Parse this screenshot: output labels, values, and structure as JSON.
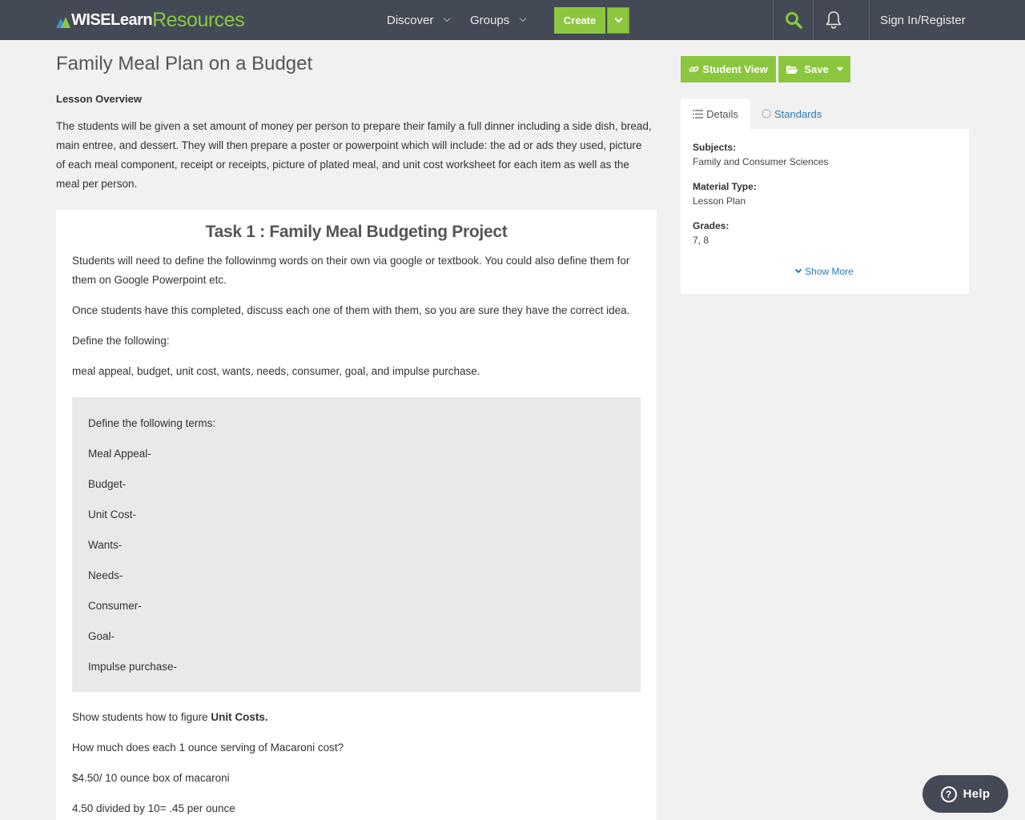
{
  "brand": {
    "part1": "WISELearn",
    "part2": "Resources"
  },
  "nav": {
    "discover": "Discover",
    "groups": "Groups",
    "create": "Create",
    "signin": "Sign In/Register"
  },
  "page": {
    "title": "Family Meal Plan on a Budget",
    "overview_label": "Lesson Overview",
    "overview_text": "The students will be given a set amount of money per person to prepare their family a full dinner including a side dish, bread, main entree, and dessert.  They will then prepare a poster or powerpoint which will include: the ad or ads they used, picture of each meal component, receipt or receipts, picture of plated meal, and unit cost worksheet for each item as well as the meal per person."
  },
  "task": {
    "title": "Task 1 : Family Meal Budgeting Project",
    "p1": "Students will need to define the followinmg words on their own via google or textbook.  You could also define them for them on Google Powerpoint etc.",
    "p2": "Once students have this completed, discuss each one of them with them, so you are sure they have the correct idea.",
    "p3": "Define the following:",
    "p4": "meal appeal, budget, unit cost, wants, needs, consumer, goal, and impulse purchase.",
    "terms_heading": "Define the following terms:",
    "terms": [
      "Meal Appeal-",
      "Budget-",
      "Unit Cost-",
      "Wants-",
      "Needs-",
      "Consumer-",
      "Goal-",
      "Impulse purchase-"
    ],
    "unit_cost_prefix": "Show students how to figure ",
    "unit_cost_bold": "Unit Costs.",
    "p6": "How much does each 1 ounce serving of Macaroni cost?",
    "p7": "$4.50/ 10 ounce box of macaroni",
    "p8": "4.50 divided by 10= .45 per ounce"
  },
  "sidebar": {
    "student_view": "Student View",
    "save": "Save",
    "tab_details": "Details",
    "tab_standards": "Standards",
    "subjects_label": "Subjects:",
    "subjects_value": "Family and Consumer Sciences",
    "material_label": "Material Type:",
    "material_value": "Lesson Plan",
    "grades_label": "Grades:",
    "grades_value": "7, 8",
    "show_more": "Show More"
  },
  "help": {
    "label": "Help"
  },
  "icons": {
    "search": "search-icon",
    "bell": "bell-icon",
    "link": "link-icon",
    "folder": "folder-open-icon",
    "list": "list-icon",
    "circle": "circle-icon",
    "question": "question-circle-icon"
  },
  "colors": {
    "nav_bg": "#444a55",
    "accent": "#8cc63f",
    "link": "#2a7bb8"
  }
}
